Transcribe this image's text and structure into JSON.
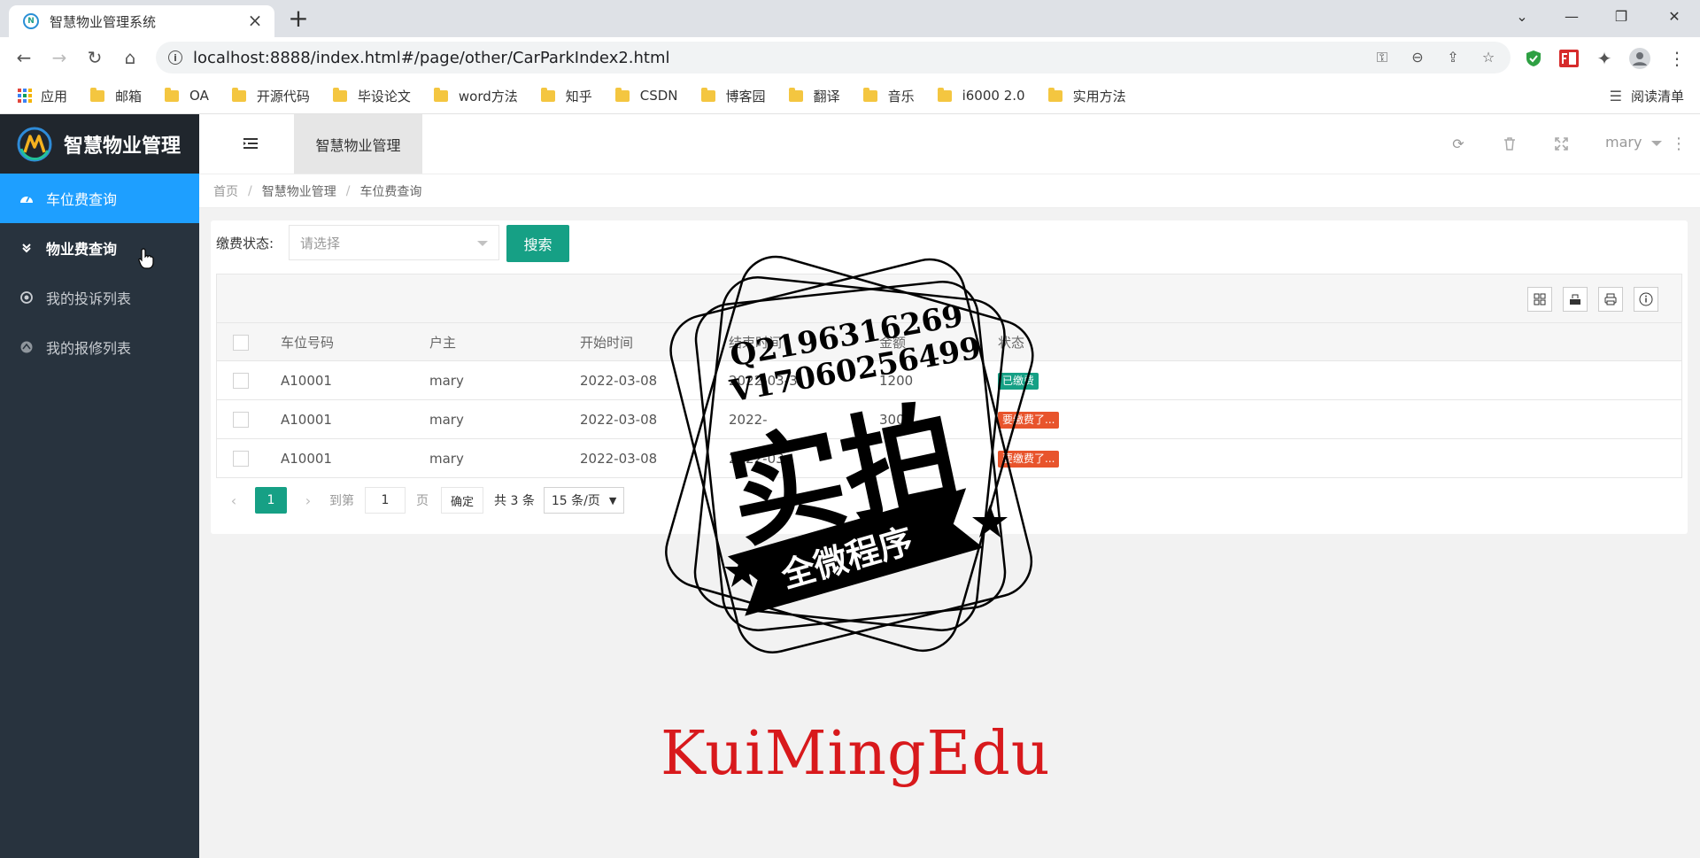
{
  "browser": {
    "tab_title": "智慧物业管理系统",
    "url": "localhost:8888/index.html#/page/other/CarParkIndex2.html",
    "bookmarks": [
      "应用",
      "邮箱",
      "OA",
      "开源代码",
      "毕设论文",
      "word方法",
      "知乎",
      "CSDN",
      "博客园",
      "翻译",
      "音乐",
      "i6000 2.0",
      "实用方法"
    ],
    "reading_list": "阅读清单"
  },
  "app": {
    "brand": "智慧物业管理",
    "header_tab": "智慧物业管理",
    "user": "mary"
  },
  "sidebar": {
    "items": [
      {
        "label": "车位费查询"
      },
      {
        "label": "物业费查询"
      },
      {
        "label": "我的投诉列表"
      },
      {
        "label": "我的报修列表"
      }
    ]
  },
  "breadcrumb": {
    "home": "首页",
    "section": "智慧物业管理",
    "current": "车位费查询"
  },
  "filter": {
    "label": "缴费状态:",
    "placeholder": "请选择",
    "search_button": "搜索"
  },
  "table": {
    "columns": [
      "车位号码",
      "户主",
      "开始时间",
      "结束时间",
      "金额",
      "状态"
    ],
    "rows": [
      {
        "code": "A10001",
        "owner": "mary",
        "start": "2022-03-08",
        "end": "2022-03-3",
        "amount": "1200",
        "status": "已缴费",
        "status_color": "#16a085"
      },
      {
        "code": "A10001",
        "owner": "mary",
        "start": "2022-03-08",
        "end": "2022-",
        "amount": "300",
        "status": "要缴费了...",
        "status_color": "#e8542c"
      },
      {
        "code": "A10001",
        "owner": "mary",
        "start": "2022-03-08",
        "end": "2022-03-",
        "amount": "",
        "status": "要缴费了...",
        "status_color": "#e8542c"
      }
    ]
  },
  "pager": {
    "current": "1",
    "goto_label": "到第",
    "page_input": "1",
    "page_unit": "页",
    "confirm": "确定",
    "total": "共 3 条",
    "page_size": "15 条/页"
  },
  "watermark": {
    "qq": "Q2196316269",
    "wechat": "V17060256499",
    "big": "实拍",
    "ribbon": "全微程序",
    "brand_text": "KuiMingEdu"
  },
  "colors": {
    "sidebar_bg": "#28333e",
    "active_menu": "#1e9fff",
    "primary": "#16a085",
    "danger": "#e8542c"
  }
}
